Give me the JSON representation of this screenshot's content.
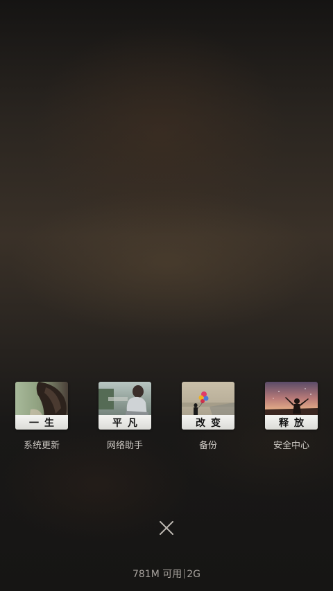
{
  "recent_apps": [
    {
      "label": "系统更新",
      "caption": "一生",
      "icon": "thumbnail-girl-hair"
    },
    {
      "label": "网络助手",
      "caption": "平凡",
      "icon": "thumbnail-girl-sitting"
    },
    {
      "label": "备份",
      "caption": "改变",
      "icon": "thumbnail-balloons"
    },
    {
      "label": "安全中心",
      "caption": "释放",
      "icon": "thumbnail-sunset-silhouette"
    }
  ],
  "close_icon": "close-icon",
  "memory": {
    "available": "781M 可用",
    "total": "2G"
  },
  "colors": {
    "label_text": "#cfcbc6",
    "memory_text": "#a7a29d"
  }
}
